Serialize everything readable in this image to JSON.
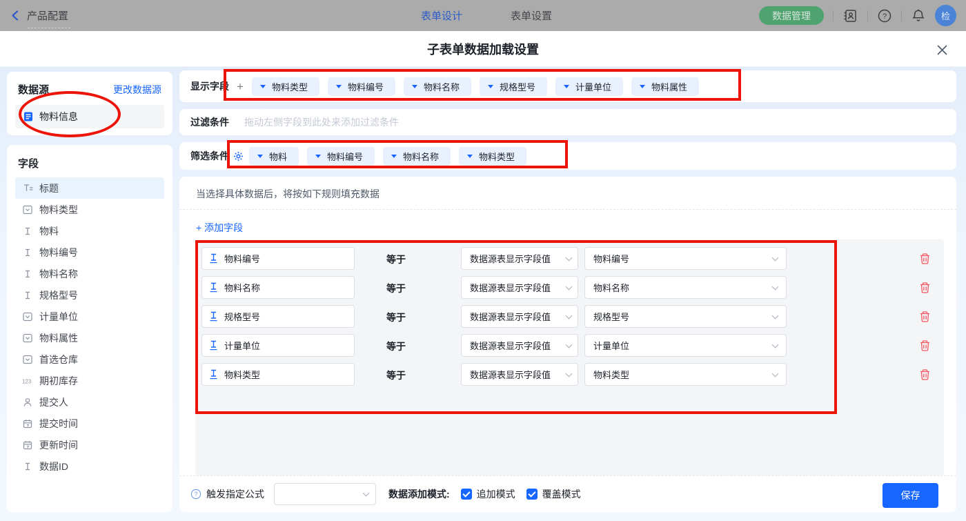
{
  "colors": {
    "primary": "#1766FF",
    "annotation_red": "#EC1407",
    "trash_red": "#F25560",
    "topbar_green_button": "#4FA36F",
    "tag_background": "#E9F1FE"
  },
  "topbar": {
    "back_label": "产品配置",
    "tabs": [
      {
        "label": "表单设计",
        "active": true
      },
      {
        "label": "表单设置",
        "active": false
      }
    ],
    "data_manage_button": "数据管理",
    "avatar_text": "检"
  },
  "modal": {
    "title": "子表单数据加载设置"
  },
  "datasource": {
    "title": "数据源",
    "change_link": "更改数据源",
    "item_label": "物料信息"
  },
  "fields": {
    "title": "字段",
    "items": [
      {
        "label": "标题",
        "icon": "title-icon",
        "selected": true
      },
      {
        "label": "物料类型",
        "icon": "select-icon",
        "selected": false
      },
      {
        "label": "物料",
        "icon": "text-icon",
        "selected": false
      },
      {
        "label": "物料编号",
        "icon": "text-icon",
        "selected": false
      },
      {
        "label": "物料名称",
        "icon": "text-icon",
        "selected": false
      },
      {
        "label": "规格型号",
        "icon": "text-icon",
        "selected": false
      },
      {
        "label": "计量单位",
        "icon": "select-icon",
        "selected": false
      },
      {
        "label": "物料属性",
        "icon": "select-icon",
        "selected": false
      },
      {
        "label": "首选仓库",
        "icon": "select-icon",
        "selected": false
      },
      {
        "label": "期初库存",
        "icon": "number-icon",
        "selected": false
      },
      {
        "label": "提交人",
        "icon": "person-icon",
        "selected": false
      },
      {
        "label": "提交时间",
        "icon": "date-icon",
        "selected": false
      },
      {
        "label": "更新时间",
        "icon": "date-icon",
        "selected": false
      },
      {
        "label": "数据ID",
        "icon": "text-icon",
        "selected": false
      }
    ]
  },
  "display_fields": {
    "label": "显示字段",
    "tags": [
      "物料类型",
      "物料编号",
      "物料名称",
      "规格型号",
      "计量单位",
      "物料属性"
    ]
  },
  "filter_condition": {
    "label": "过滤条件",
    "placeholder": "拖动左侧字段到此处来添加过滤条件"
  },
  "screen_condition": {
    "label": "筛选条件",
    "tags": [
      "物料",
      "物料编号",
      "物料名称",
      "物料类型"
    ]
  },
  "fill_rules": {
    "hint": "当选择具体数据后，将按如下规则填充数据",
    "add_field_link": "+ 添加字段",
    "rows": [
      {
        "field": "物料编号",
        "operator": "等于",
        "source": "数据源表显示字段值",
        "target": "物料编号"
      },
      {
        "field": "物料名称",
        "operator": "等于",
        "source": "数据源表显示字段值",
        "target": "物料名称"
      },
      {
        "field": "规格型号",
        "operator": "等于",
        "source": "数据源表显示字段值",
        "target": "规格型号"
      },
      {
        "field": "计量单位",
        "operator": "等于",
        "source": "数据源表显示字段值",
        "target": "计量单位"
      },
      {
        "field": "物料类型",
        "operator": "等于",
        "source": "数据源表显示字段值",
        "target": "物料类型"
      }
    ]
  },
  "footer": {
    "formula_label": "触发指定公式",
    "formula_value": "",
    "mode_label": "数据添加模式:",
    "modes": [
      {
        "label": "追加模式",
        "checked": true
      },
      {
        "label": "覆盖模式",
        "checked": true
      }
    ],
    "save_button": "保存"
  }
}
